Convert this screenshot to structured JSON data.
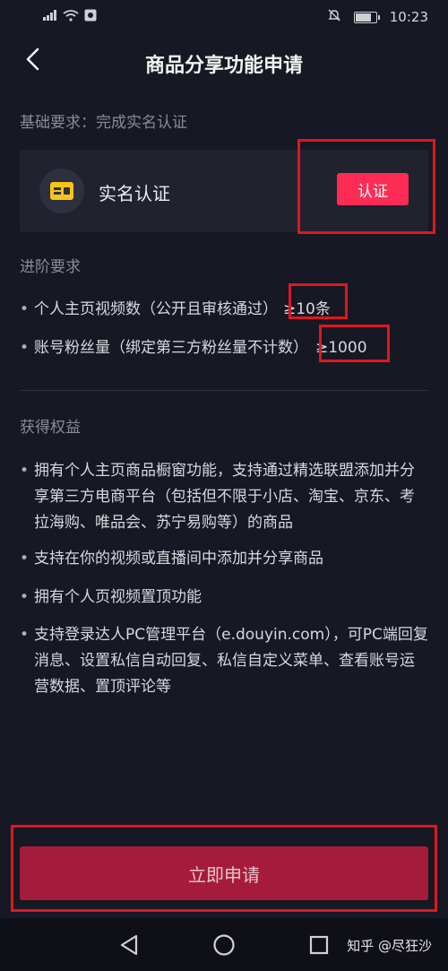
{
  "status_bar": {
    "signal_icon": "signal-icon",
    "wifi_icon": "wifi-icon",
    "notification_icon": "app-notification-icon",
    "mute_icon": "mute-bell-icon",
    "battery_icon": "battery-icon",
    "time": "10:23"
  },
  "header": {
    "back_icon": "chevron-left-icon",
    "title": "商品分享功能申请"
  },
  "basic": {
    "section_label": "基础要求：完成实名认证",
    "card_icon": "id-card-icon",
    "card_label": "实名认证",
    "verify_button": "认证"
  },
  "advanced": {
    "section_label": "进阶要求",
    "items": [
      {
        "text": "个人主页视频数（公开且审核通过）",
        "value": "≥10条"
      },
      {
        "text": "账号粉丝量（绑定第三方粉丝量不计数）",
        "value": "≥1000"
      }
    ]
  },
  "benefits": {
    "section_label": "获得权益",
    "items": [
      "拥有个人主页商品橱窗功能，支持通过精选联盟添加并分享第三方电商平台（包括但不限于小店、淘宝、京东、考拉海购、唯品会、苏宁易购等）的商品",
      "支持在你的视频或直播间中添加并分享商品",
      "拥有个人页视频置顶功能",
      "支持登录达人PC管理平台（e.douyin.com），可PC端回复消息、设置私信自动回复、私信自定义菜单、查看账号运营数据、置顶评论等"
    ]
  },
  "footer": {
    "apply_button": "立即申请"
  },
  "system_nav": {
    "back_icon": "triangle-back-icon",
    "home_icon": "circle-home-icon",
    "recents_icon": "square-recents-icon",
    "watermark": "知乎 @尽狂沙"
  },
  "colors": {
    "background": "#161823",
    "accent": "#fe2c55",
    "apply_button": "#a51c3b",
    "highlight_box": "#e0161f"
  }
}
